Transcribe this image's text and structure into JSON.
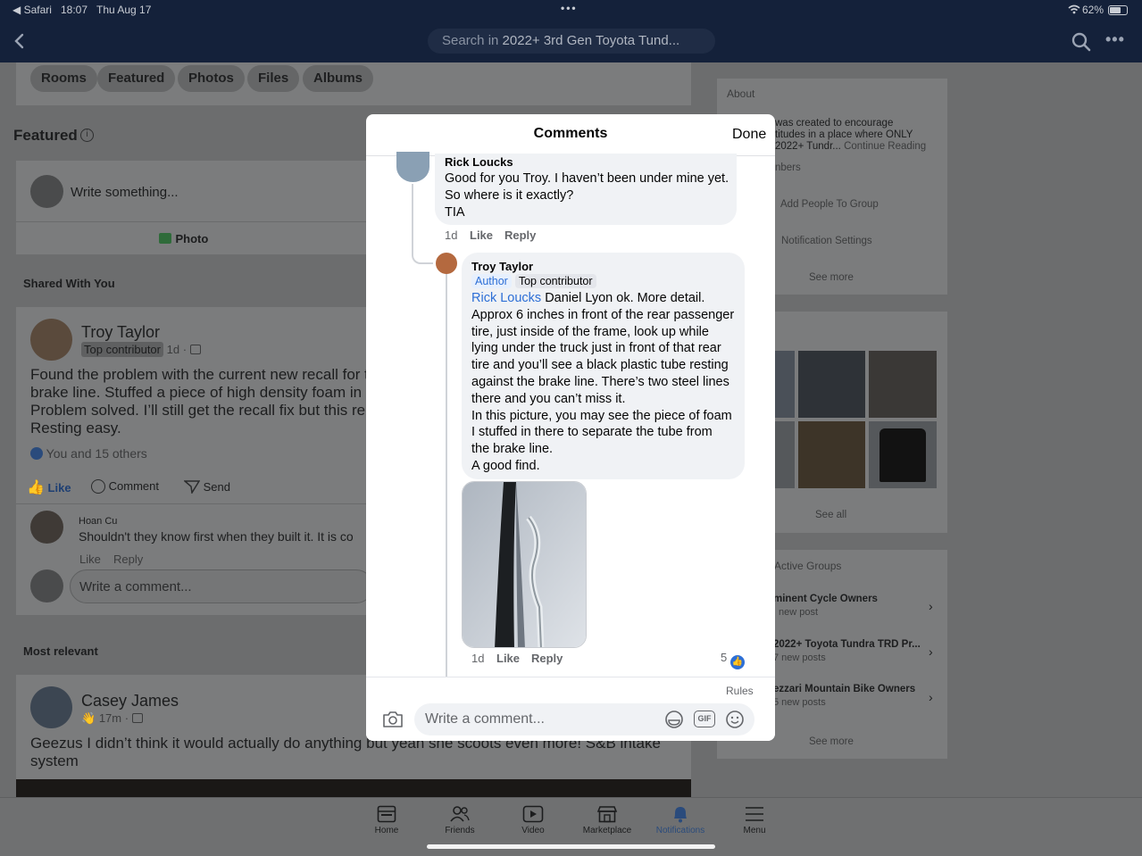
{
  "status_bar": {
    "back_app": "◀ Safari",
    "time": "18:07",
    "date": "Thu Aug 17",
    "battery": "62%"
  },
  "nav": {
    "search_prefix": "Search in",
    "search_group": "2022+ 3rd Gen Toyota Tund..."
  },
  "group_tabs": [
    "Rooms",
    "Featured",
    "Photos",
    "Files",
    "Albums"
  ],
  "featured": {
    "title": "Featured"
  },
  "composer": {
    "placeholder": "Write something...",
    "photo_label": "Photo"
  },
  "shared": {
    "section_title": "Shared With You",
    "author": "Troy Taylor",
    "badge": "Top contributor",
    "time": "1d ·",
    "text_lines": [
      "Found the problem with the current new recall for t",
      "brake line. Stuffed a piece of high density foam in t",
      "Problem solved. I’ll still get the recall fix but this re",
      "Resting easy."
    ],
    "reactions": "You and 15 others",
    "actions": {
      "like": "Like",
      "comment": "Comment",
      "send": "Send"
    },
    "comment_author": "Hoan Cu",
    "comment_text": "Shouldn't they know first when they built it. It is co",
    "comment_like": "Like",
    "comment_reply": "Reply",
    "write_placeholder": "Write a comment..."
  },
  "most_relevant": {
    "section_title": "Most relevant",
    "author": "Casey James",
    "time": "17m ·",
    "text_lines": [
      "Geezus I didn’t think it would actually do anything but yeah she scoots even more! S&B intake",
      "system"
    ]
  },
  "right_panel": {
    "about_title": "About",
    "about_lines": [
      "was created to encourage",
      "titudes in a place where ONLY",
      "2022+ Tundr..."
    ],
    "continue_reading": "Continue Reading",
    "members": "nbers",
    "add_people": "Add People To Group",
    "notification_settings": "Notification Settings",
    "see_more_1": "See more",
    "see_all": "See all",
    "active_groups_title": "Active Groups",
    "groups": [
      {
        "name": "minent Cycle Owners",
        "posts": "new post"
      },
      {
        "name": "2022+ Toyota Tundra TRD Pr...",
        "posts": "7 new posts"
      },
      {
        "name": "ezzari Mountain Bike Owners",
        "posts": "5 new posts"
      }
    ],
    "see_more_2": "See more"
  },
  "modal": {
    "title": "Comments",
    "done": "Done",
    "comment1": {
      "author": "Rick Loucks",
      "lines": [
        "Good for you Troy. I haven’t been under mine yet.",
        "So where is it exactly?",
        "TIA"
      ],
      "time": "1d",
      "like": "Like",
      "reply": "Reply"
    },
    "comment2": {
      "author": "Troy Taylor",
      "badge_author": "Author",
      "badge_top": "Top contributor",
      "mention": "Rick Loucks",
      "first_line_rest": " Daniel Lyon ok. More detail.",
      "lines": [
        "Approx 6 inches in front of the rear passenger",
        "tire, just inside of the frame, look up while",
        "lying under the truck just in front of that rear",
        "tire and you’ll see a black plastic tube resting",
        "against the brake line. There’s two steel lines",
        "there and you can’t miss it.",
        "In this picture, you may see the piece of foam",
        "I stuffed in there to separate the tube from",
        "the brake line.",
        "A good find."
      ],
      "time": "1d",
      "like": "Like",
      "reply": "Reply",
      "reaction_count": "5"
    },
    "rules": "Rules",
    "input_placeholder": "Write a comment..."
  },
  "tabbar": [
    "Home",
    "Friends",
    "Video",
    "Marketplace",
    "Notifications",
    "Menu"
  ]
}
